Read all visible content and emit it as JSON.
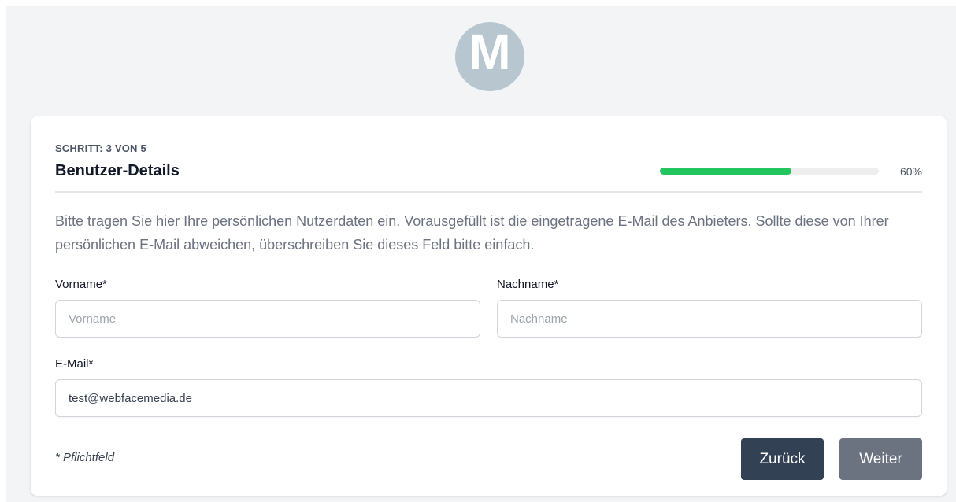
{
  "logo": {
    "letter": "M",
    "color": "#b8c7cf"
  },
  "step": {
    "label": "SCHRITT: 3 VON 5",
    "title": "Benutzer-Details",
    "progress_percent": 60,
    "progress_text": "60%",
    "progress_color": "#22c55e"
  },
  "form": {
    "description": "Bitte tragen Sie hier Ihre persönlichen Nutzerdaten ein. Vorausgefüllt ist die eingetragene E-Mail des Anbieters. Sollte diese von Ihrer persönlichen E-Mail abweichen, überschreiben Sie dieses Feld bitte einfach.",
    "firstname": {
      "label": "Vorname*",
      "placeholder": "Vorname",
      "value": ""
    },
    "lastname": {
      "label": "Nachname*",
      "placeholder": "Nachname",
      "value": ""
    },
    "email": {
      "label": "E-Mail*",
      "value": "test@webfacemedia.de"
    },
    "footnote": "* Pflichtfeld"
  },
  "actions": {
    "back_label": "Zurück",
    "next_label": "Weiter",
    "back_color": "#334155",
    "next_color": "#6b7280"
  }
}
